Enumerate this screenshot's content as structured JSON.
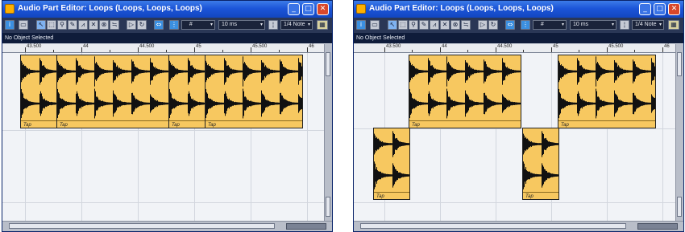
{
  "window_title": "Audio Part Editor: Loops (Loops, Loops, Loops)",
  "status_text": "No Object Selected",
  "toolbar": {
    "grid_label": "10 ms",
    "quantize_label": "1/4 Note"
  },
  "ruler_labels": [
    "43.500",
    "44",
    "44.500",
    "45",
    "45.500",
    "46"
  ],
  "event_name": "Tap",
  "colors": {
    "title_bar": "#1c55d8",
    "toolbar": "#2a3756",
    "event_fill": "#f7c860",
    "track_bg": "#f1f3f7"
  },
  "icons": {
    "app": "cubase-app-icon",
    "minimize": "minimize-icon",
    "maximize": "maximize-icon",
    "close": "close-icon"
  }
}
